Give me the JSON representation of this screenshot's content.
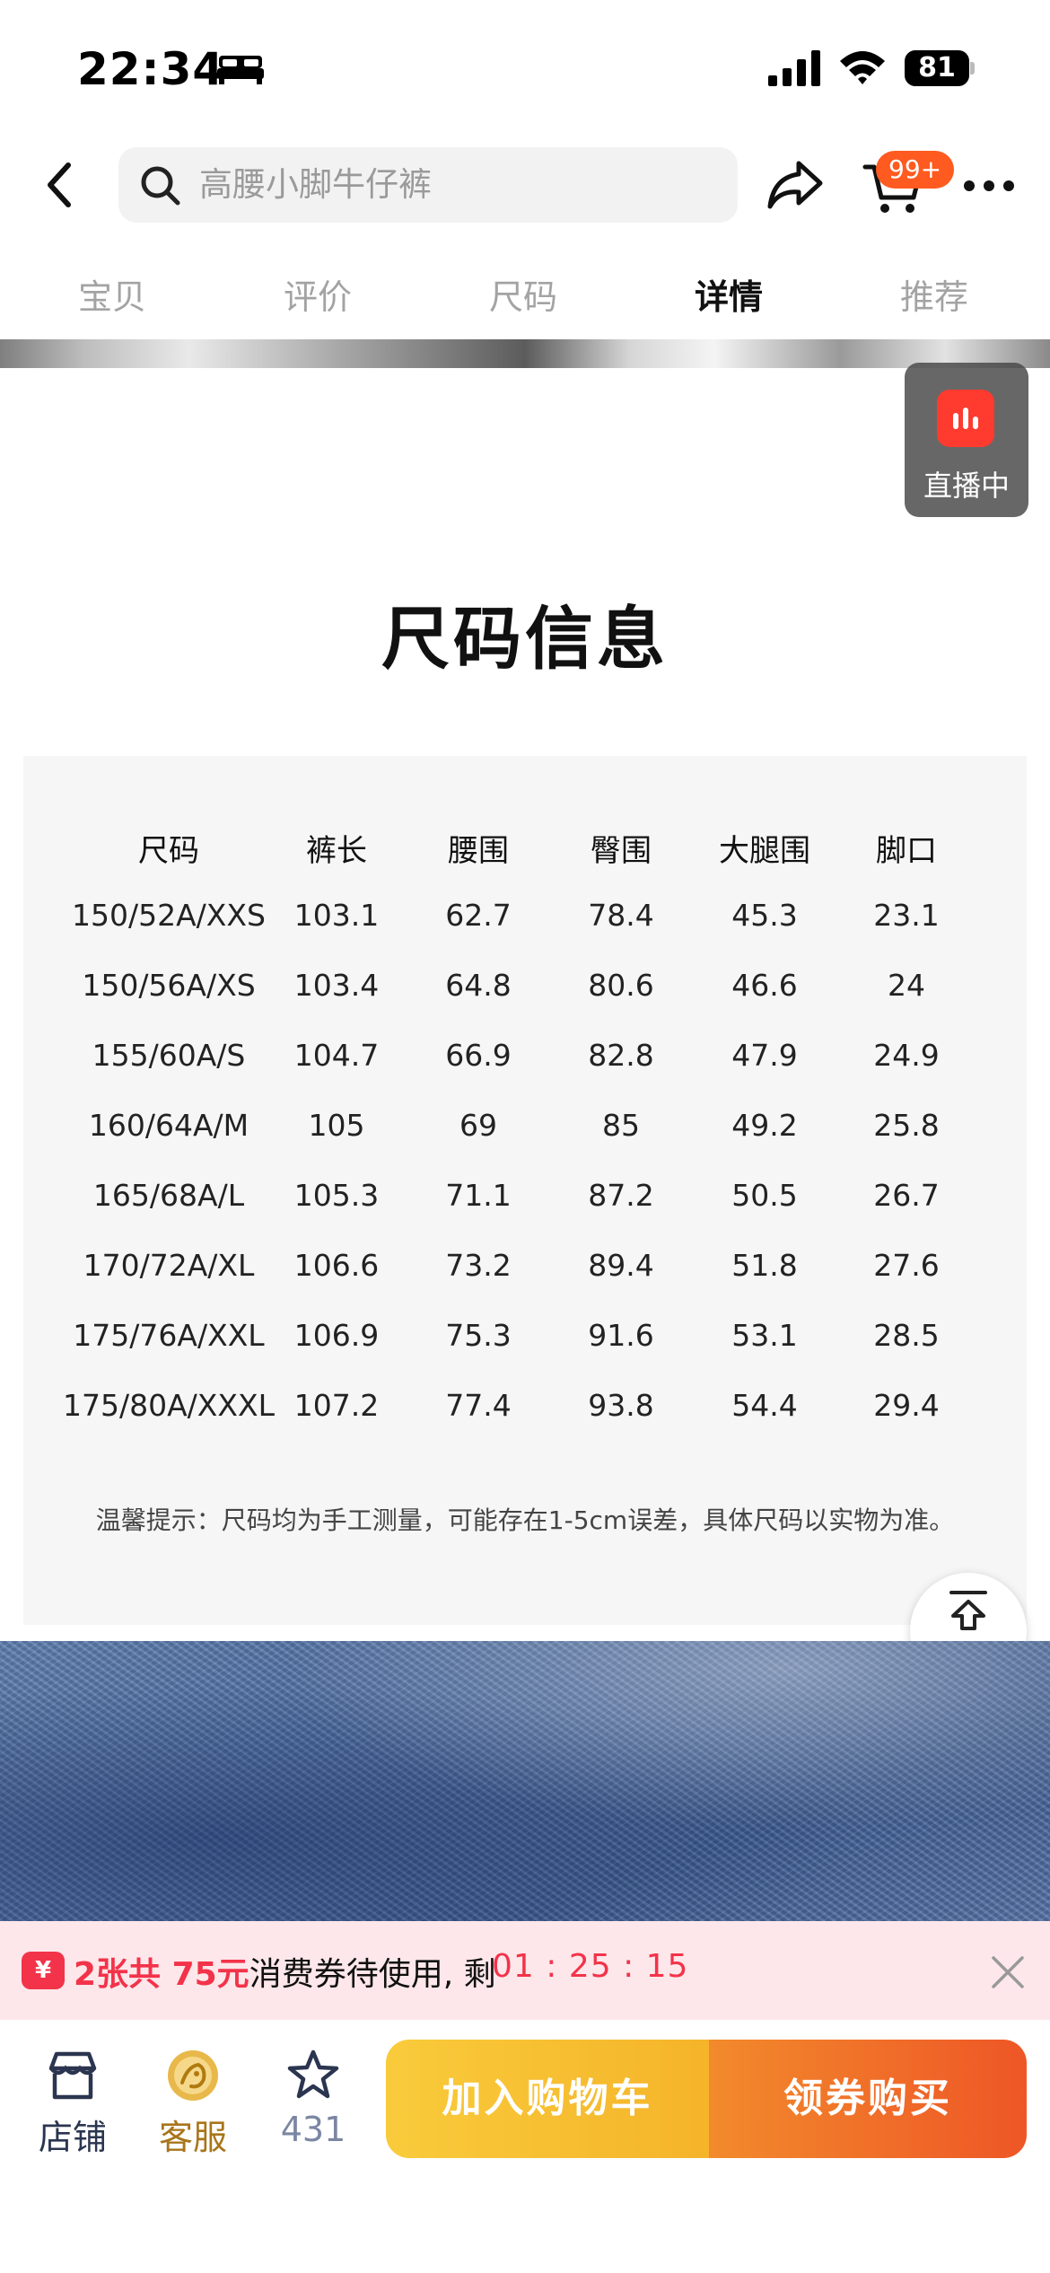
{
  "status_bar": {
    "time": "22:34",
    "battery": "81"
  },
  "header": {
    "search_placeholder": "高腰小脚牛仔裤",
    "cart_badge": "99+"
  },
  "tabs": [
    {
      "label": "宝贝"
    },
    {
      "label": "评价"
    },
    {
      "label": "尺码"
    },
    {
      "label": "详情",
      "active": true
    },
    {
      "label": "推荐"
    }
  ],
  "live": {
    "label": "直播中"
  },
  "size_info": {
    "title": "尺码信息",
    "columns": [
      "尺码",
      "裤长",
      "腰围",
      "臀围",
      "大腿围",
      "脚口"
    ],
    "rows": [
      [
        "150/52A/XXS",
        "103.1",
        "62.7",
        "78.4",
        "45.3",
        "23.1"
      ],
      [
        "150/56A/XS",
        "103.4",
        "64.8",
        "80.6",
        "46.6",
        "24"
      ],
      [
        "155/60A/S",
        "104.7",
        "66.9",
        "82.8",
        "47.9",
        "24.9"
      ],
      [
        "160/64A/M",
        "105",
        "69",
        "85",
        "49.2",
        "25.8"
      ],
      [
        "165/68A/L",
        "105.3",
        "71.1",
        "87.2",
        "50.5",
        "26.7"
      ],
      [
        "170/72A/XL",
        "106.6",
        "73.2",
        "89.4",
        "51.8",
        "27.6"
      ],
      [
        "175/76A/XXL",
        "106.9",
        "75.3",
        "91.6",
        "53.1",
        "28.5"
      ],
      [
        "175/80A/XXXL",
        "107.2",
        "77.4",
        "93.8",
        "54.4",
        "29.4"
      ]
    ],
    "note": "温馨提示：尺码均为手工测量，可能存在1-5cm误差，具体尺码以实物为准。"
  },
  "back_to_top": {
    "label": "顶部"
  },
  "coupon": {
    "icon_text": "¥",
    "highlight": "2张共 75元",
    "text": "消费券待使用, 剩",
    "timer": "01 : 25 : 15"
  },
  "bottom_bar": {
    "shop_label": "店铺",
    "service_label": "客服",
    "favorite_count": "431",
    "add_to_cart_label": "加入购物车",
    "buy_label": "领券购买"
  },
  "colors": {
    "accent_red": "#f2334a",
    "cart_button": "#f5b42a",
    "buy_button": "#ee5626",
    "badge_orange": "#ff5a1f"
  },
  "icons": [
    "bed-icon",
    "signal-icon",
    "wifi-icon",
    "battery-icon",
    "back-icon",
    "search-icon",
    "share-icon",
    "cart-icon",
    "more-icon",
    "live-icon",
    "back-to-top-icon",
    "coupon-icon",
    "close-icon",
    "shop-icon",
    "service-icon",
    "star-icon"
  ]
}
